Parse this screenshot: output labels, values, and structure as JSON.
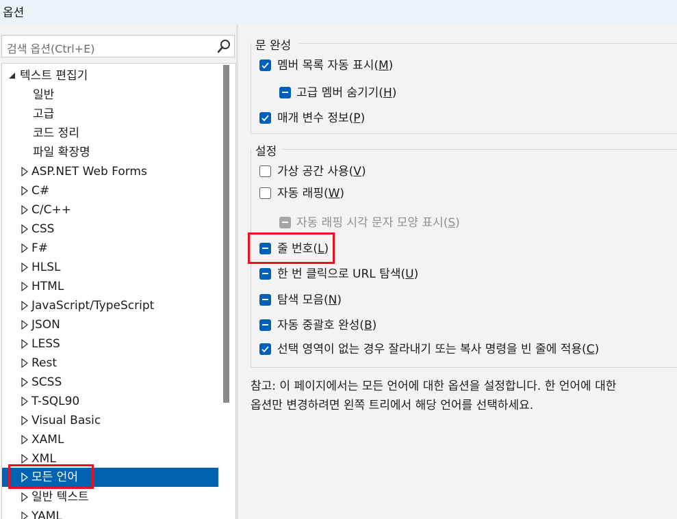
{
  "window": {
    "title": "옵션"
  },
  "search": {
    "placeholder": "검색 옵션(Ctrl+E)",
    "icon": "search-icon"
  },
  "tree": {
    "root": "텍스트 편집기",
    "children": [
      "일반",
      "고급",
      "코드 정리",
      "파일 확장명"
    ],
    "languages": [
      "ASP.NET Web Forms",
      "C#",
      "C/C++",
      "CSS",
      "F#",
      "HLSL",
      "HTML",
      "JavaScript/TypeScript",
      "JSON",
      "LESS",
      "Rest",
      "SCSS",
      "T-SQL90",
      "Visual Basic",
      "XAML",
      "XML",
      "모든 언어",
      "일반 텍스트",
      "YAML"
    ],
    "selected": "모든 언어",
    "selection_color": "#0063b1"
  },
  "statement_completion": {
    "title": "문 완성",
    "auto_list": {
      "label": "멤버 목록 자동 표시",
      "key": "M",
      "state": "checked"
    },
    "hide_advanced": {
      "label": "고급 멤버 숨기기",
      "key": "H",
      "state": "indeterminate"
    },
    "param_info": {
      "label": "매개 변수 정보",
      "key": "P",
      "state": "checked"
    }
  },
  "settings": {
    "title": "설정",
    "virtual_space": {
      "label": "가상 공간 사용",
      "key": "V",
      "state": "unchecked"
    },
    "word_wrap": {
      "label": "자동 래핑",
      "key": "W",
      "state": "unchecked"
    },
    "wrap_glyphs": {
      "label": "자동 래핑 시각 문자 모양 표시",
      "key": "S",
      "state": "disabled"
    },
    "line_numbers": {
      "label": "줄 번호",
      "key": "L",
      "state": "indeterminate"
    },
    "url_nav": {
      "label": "한 번 클릭으로 URL 탐색",
      "key": "U",
      "state": "indeterminate"
    },
    "nav_bar": {
      "label": "탐색 모음",
      "key": "N",
      "state": "indeterminate"
    },
    "auto_brace": {
      "label": "자동 중괄호 완성",
      "key": "B",
      "state": "indeterminate"
    },
    "cut_copy_blank": {
      "label": "선택 영역이 없는 경우 잘라내기 또는 복사 명령을 빈 줄에 적용",
      "key": "C",
      "state": "checked"
    }
  },
  "note": {
    "line1": "참고: 이 페이지에서는 모든 언어에 대한 옵션을 설정합니다. 한 언어에 대한",
    "line2": "옵션만 변경하려면 왼쪽 트리에서 해당 언어를 선택하세요."
  },
  "colors": {
    "accent": "#005fb8",
    "highlight": "#e81123"
  }
}
